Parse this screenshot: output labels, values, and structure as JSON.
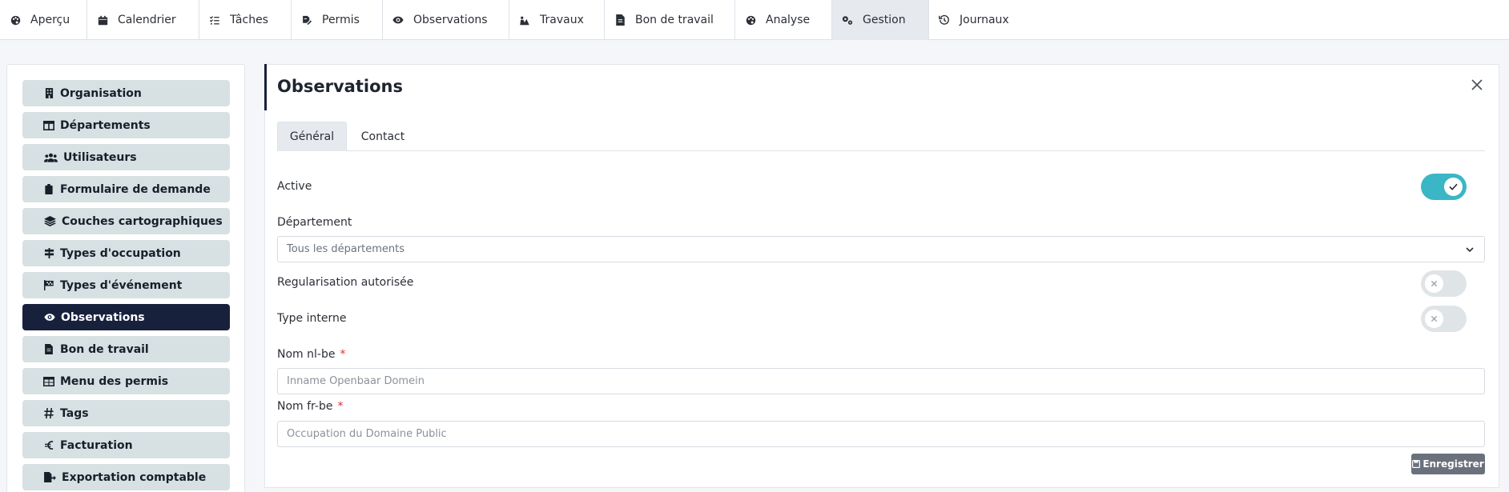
{
  "nav": {
    "tabs": [
      {
        "label": "Aperçu",
        "icon": "palette-icon"
      },
      {
        "label": "Calendrier",
        "icon": "calendar-icon"
      },
      {
        "label": "Tâches",
        "icon": "checklist-icon"
      },
      {
        "label": "Permis",
        "icon": "file-signature-icon"
      },
      {
        "label": "Observations",
        "icon": "eye-icon"
      },
      {
        "label": "Travaux",
        "icon": "worker-icon"
      },
      {
        "label": "Bon de travail",
        "icon": "file-icon"
      },
      {
        "label": "Analyse",
        "icon": "palette-icon"
      },
      {
        "label": "Gestion",
        "icon": "gears-icon",
        "active": true
      },
      {
        "label": "Journaux",
        "icon": "history-icon"
      }
    ]
  },
  "sidebar": {
    "items": [
      {
        "label": "Organisation",
        "icon": "building-icon"
      },
      {
        "label": "Départements",
        "icon": "columns-icon"
      },
      {
        "label": "Utilisateurs",
        "icon": "users-icon"
      },
      {
        "label": "Formulaire de demande",
        "icon": "clipboard-icon"
      },
      {
        "label": "Couches cartographiques",
        "icon": "layers-icon"
      },
      {
        "label": "Types d'occupation",
        "icon": "signpost-icon"
      },
      {
        "label": "Types d'événement",
        "icon": "flag-icon"
      },
      {
        "label": "Observations",
        "icon": "eye-icon",
        "active": true
      },
      {
        "label": "Bon de travail",
        "icon": "file-icon"
      },
      {
        "label": "Menu des permis",
        "icon": "table-icon"
      },
      {
        "label": "Tags",
        "icon": "hashtag-icon"
      },
      {
        "label": "Facturation",
        "icon": "euro-icon"
      },
      {
        "label": "Exportation comptable",
        "icon": "file-export-icon"
      }
    ]
  },
  "panel": {
    "title": "Observations",
    "tabs": [
      {
        "label": "Général",
        "active": true
      },
      {
        "label": "Contact"
      }
    ],
    "fields": {
      "active_label": "Active",
      "active_value": true,
      "department_label": "Département",
      "department_value": "Tous les départements",
      "regularisation_label": "Regularisation autorisée",
      "regularisation_value": false,
      "internal_label": "Type interne",
      "internal_value": false,
      "name_nl_label": "Nom nl-be",
      "name_nl_value": "Inname Openbaar Domein",
      "name_fr_label": "Nom fr-be",
      "name_fr_value": "Occupation du Domaine Public",
      "required_mark": "*"
    },
    "save_label": "Enregistrer"
  },
  "colors": {
    "accent": "#3bb6c6",
    "sidebar_active": "#18213c",
    "sidebar_item": "#d7e1e3",
    "save_button": "#6b717c",
    "required": "#e03131"
  }
}
